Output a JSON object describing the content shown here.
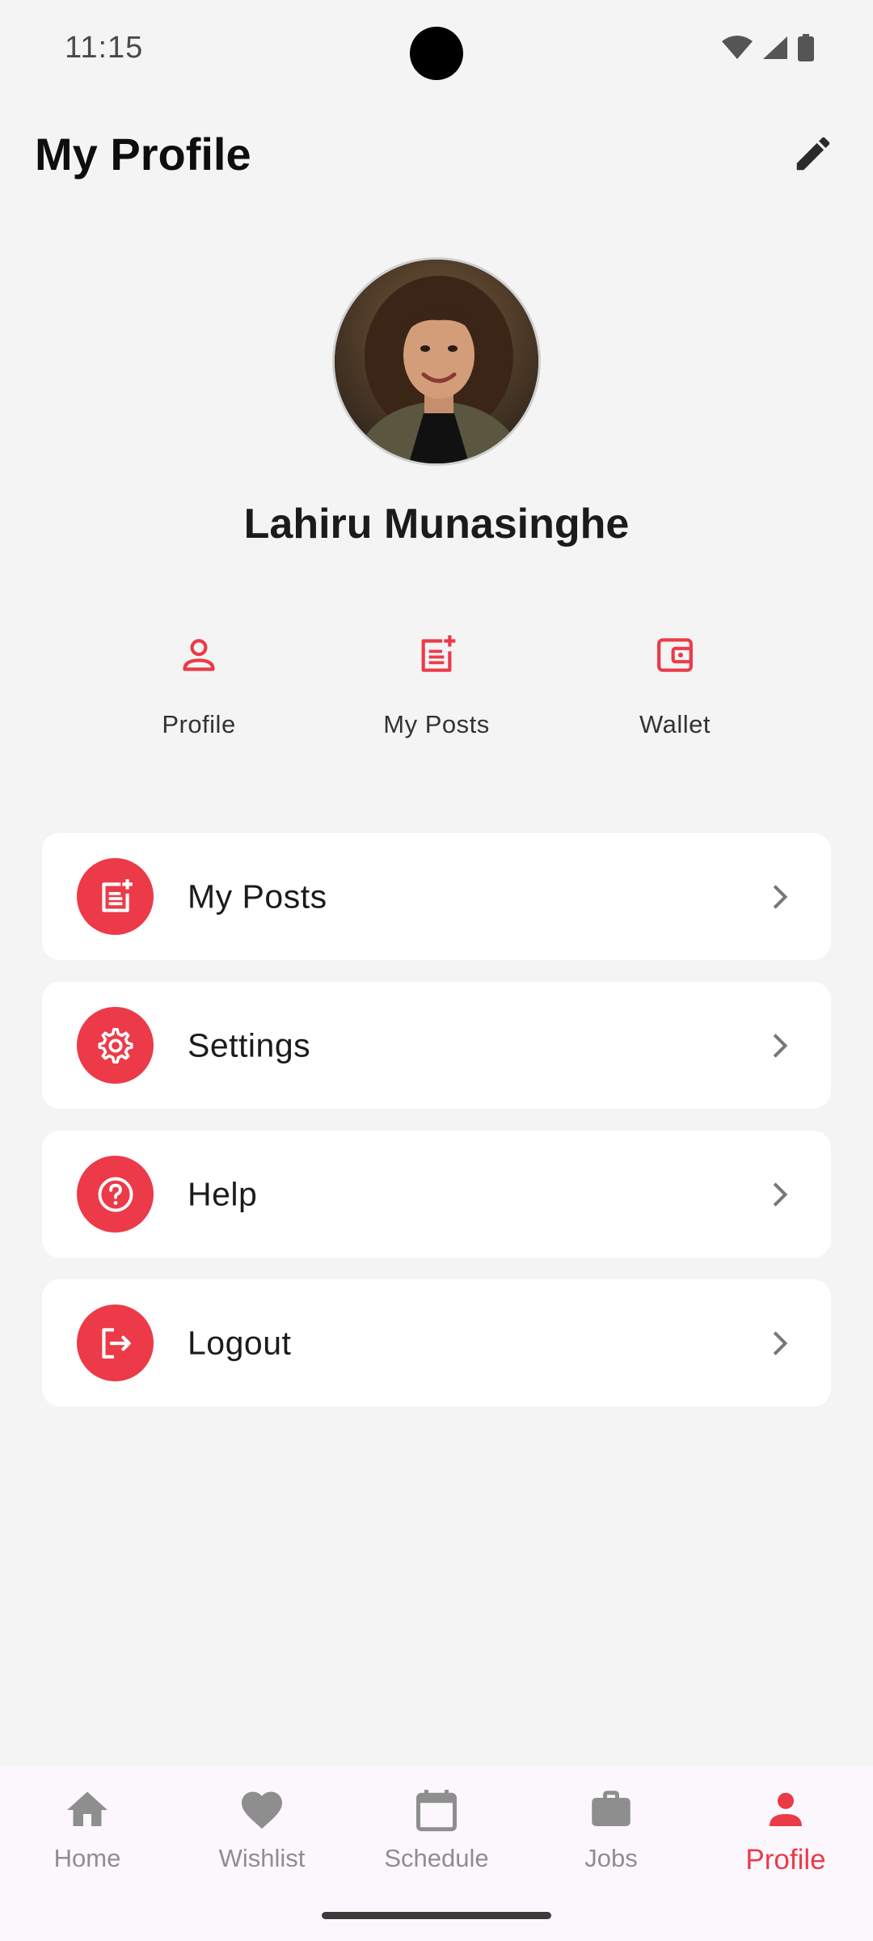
{
  "status_bar": {
    "time": "11:15"
  },
  "header": {
    "title": "My Profile",
    "edit_icon": "pencil-icon"
  },
  "profile": {
    "name": "Lahiru Munasinghe",
    "avatar_icon": "user-photo"
  },
  "quick_actions": [
    {
      "label": "Profile",
      "icon": "person-outline-icon"
    },
    {
      "label": "My Posts",
      "icon": "post-add-icon"
    },
    {
      "label": "Wallet",
      "icon": "wallet-icon"
    }
  ],
  "menu": [
    {
      "label": "My Posts",
      "icon": "post-add-icon"
    },
    {
      "label": "Settings",
      "icon": "gear-icon"
    },
    {
      "label": "Help",
      "icon": "help-icon"
    },
    {
      "label": "Logout",
      "icon": "logout-icon"
    }
  ],
  "bottom_nav": [
    {
      "label": "Home",
      "icon": "home-icon",
      "active": false
    },
    {
      "label": "Wishlist",
      "icon": "heart-icon",
      "active": false
    },
    {
      "label": "Schedule",
      "icon": "calendar-icon",
      "active": false
    },
    {
      "label": "Jobs",
      "icon": "briefcase-icon",
      "active": false
    },
    {
      "label": "Profile",
      "icon": "person-icon",
      "active": true
    }
  ],
  "colors": {
    "accent": "#ec3a49",
    "background": "#f4f4f4",
    "card": "#ffffff",
    "nav_inactive": "#8e8e8e",
    "nav_background": "#fcf7fc"
  }
}
